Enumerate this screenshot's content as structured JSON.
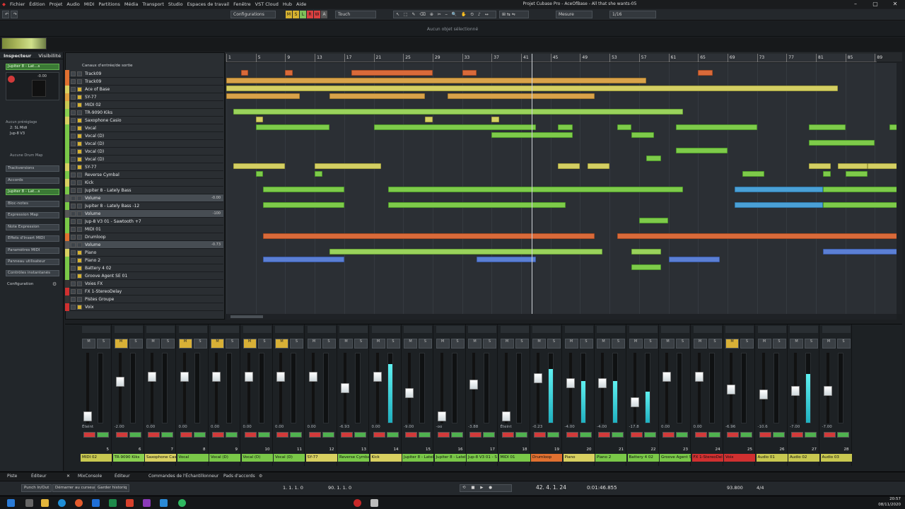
{
  "menu": [
    "Fichier",
    "Édition",
    "Projet",
    "Audio",
    "MIDI",
    "Partitions",
    "Média",
    "Transport",
    "Studio",
    "Espaces de travail",
    "Fenêtre",
    "VST Cloud",
    "Hub",
    "Aide"
  ],
  "window_title": "Projet Cubase Pro - AceOfBase - All that she wants-05",
  "toolbar": {
    "configurations": "Configurations",
    "mode": "Touch",
    "grid_type": "Mesure",
    "quantize": "1/16",
    "msrw": [
      "M",
      "S",
      "L",
      "R",
      "W",
      "A"
    ]
  },
  "info_line": "Aucun objet sélectionné",
  "inspector": {
    "tabs": [
      "Inspecteur",
      "Visibilité"
    ],
    "track": "Jupiter 8 - Lat...s",
    "preset": "Aucun préréglage",
    "instrument": "2: SL Midi",
    "output": "Jup-8 V3",
    "drum_map": "Aucune Drum Map",
    "sections": [
      "Trackversions",
      "Accords",
      "Jupiter 8 - Lat...s",
      "Bloc-notes",
      "Expression Map",
      "Note Expression",
      "Effets d'Insert MIDI",
      "Paramètres MIDI",
      "Panneau utilisateur",
      "Contrôles instantanés",
      "Configuration"
    ],
    "meter_val": "-0.00"
  },
  "track_header": "Canaux d'entrée/de sortie",
  "tracks": [
    {
      "name": "Track09",
      "color": "#e07030",
      "solo": false
    },
    {
      "name": "Track09",
      "color": "#e07030",
      "solo": false
    },
    {
      "name": "Ace of Base",
      "color": "#d8d060",
      "solo": true
    },
    {
      "name": "SY-77",
      "color": "#e0a040",
      "solo": true
    },
    {
      "name": "MIDI 02",
      "color": "#c8c850",
      "solo": true
    },
    {
      "name": "TR-9090 Kiks",
      "color": "#8ad050",
      "solo": false
    },
    {
      "name": "Saxophone Casio",
      "color": "#d8d060",
      "solo": true
    },
    {
      "name": "Vocal",
      "color": "#7ac848",
      "solo": true
    },
    {
      "name": "Vocal (D)",
      "color": "#7ac848",
      "solo": true
    },
    {
      "name": "Vocal (D)",
      "color": "#7ac848",
      "solo": true
    },
    {
      "name": "Vocal (D)",
      "color": "#7ac848",
      "solo": true
    },
    {
      "name": "Vocal (D)",
      "color": "#7ac848",
      "solo": true
    },
    {
      "name": "SY-77",
      "color": "#d8d060",
      "solo": true
    },
    {
      "name": "Reverse Cymbal",
      "color": "#7ac848",
      "solo": false
    },
    {
      "name": "Kick",
      "color": "#d8d060",
      "solo": false
    },
    {
      "name": "Jupiter 8 - Lately Bass",
      "color": "#7ac848",
      "solo": false
    },
    {
      "name": "Volume",
      "color": "#555",
      "solo": false,
      "value": "-0.00"
    },
    {
      "name": "Jupiter 8 - Lately Bass -12",
      "color": "#7ac848",
      "solo": false
    },
    {
      "name": "Volume",
      "color": "#555",
      "solo": false,
      "value": "-100"
    },
    {
      "name": "Jup-8 V3 01 - Sawtooth +7",
      "color": "#7ac848",
      "solo": false
    },
    {
      "name": "MIDI 01",
      "color": "#7ac848",
      "solo": false
    },
    {
      "name": "Drumloop",
      "color": "#e07030",
      "solo": false
    },
    {
      "name": "Volume",
      "color": "#555",
      "solo": false,
      "value": "-0.73"
    },
    {
      "name": "Piano",
      "color": "#d8d060",
      "solo": true
    },
    {
      "name": "Piano 2",
      "color": "#7ac848",
      "solo": true
    },
    {
      "name": "Battery 4 02",
      "color": "#7ac848",
      "solo": true
    },
    {
      "name": "Groove Agent SE 01",
      "color": "#7ac848",
      "solo": true
    },
    {
      "name": "Voies FX",
      "color": "#333",
      "solo": false
    },
    {
      "name": "FX 1-StereoDelay",
      "color": "#d03030",
      "solo": false
    },
    {
      "name": "Pistes Groupe",
      "color": "#333",
      "solo": false
    },
    {
      "name": "Voix",
      "color": "#d03030",
      "solo": true
    }
  ],
  "ruler": [
    "1",
    "5",
    "9",
    "13",
    "17",
    "21",
    "25",
    "29",
    "33",
    "37",
    "41",
    "45",
    "49",
    "53",
    "57",
    "61",
    "65",
    "69",
    "73",
    "77",
    "81",
    "85",
    "89"
  ],
  "mixer": {
    "channels": [
      {
        "num": "5",
        "label": "MIDI 02",
        "color": "#c8c850",
        "val": "Éteint",
        "fader": 0.08,
        "meter": 0,
        "m": false
      },
      {
        "num": "6",
        "label": "TR-9090 Kiks",
        "color": "#8ad050",
        "val": "-2.00",
        "fader": 0.62,
        "meter": 0,
        "m": true
      },
      {
        "num": "7",
        "label": "Saxophone Cas",
        "color": "#d8d060",
        "val": "0.00",
        "fader": 0.7,
        "meter": 0,
        "m": false
      },
      {
        "num": "8",
        "label": "Vocal",
        "color": "#7ac848",
        "val": "0.00",
        "fader": 0.7,
        "meter": 0,
        "m": true
      },
      {
        "num": "9",
        "label": "Vocal (D)",
        "color": "#7ac848",
        "val": "0.00",
        "fader": 0.7,
        "meter": 0,
        "m": true
      },
      {
        "num": "10",
        "label": "Vocal (D)",
        "color": "#7ac848",
        "val": "0.00",
        "fader": 0.7,
        "meter": 0,
        "m": true
      },
      {
        "num": "11",
        "label": "Vocal (D)",
        "color": "#7ac848",
        "val": "0.00",
        "fader": 0.7,
        "meter": 0,
        "m": true
      },
      {
        "num": "12",
        "label": "SY-77",
        "color": "#d8d060",
        "val": "0.00",
        "fader": 0.7,
        "meter": 0,
        "m": false
      },
      {
        "num": "13",
        "label": "Reverse Cymba",
        "color": "#7ac848",
        "val": "-6.93",
        "fader": 0.52,
        "meter": 0,
        "m": false
      },
      {
        "num": "14",
        "label": "Kick",
        "color": "#d8d060",
        "val": "0.00",
        "fader": 0.7,
        "meter": 0.85,
        "m": false
      },
      {
        "num": "15",
        "label": "Jupiter 8 - Latel",
        "color": "#7ac848",
        "val": "-9.00",
        "fader": 0.45,
        "meter": 0,
        "m": false
      },
      {
        "num": "16",
        "label": "Jupiter 8 - Latel",
        "color": "#7ac848",
        "val": "-oo",
        "fader": 0.08,
        "meter": 0,
        "m": false
      },
      {
        "num": "17",
        "label": "Jup-8 V3 01 - S",
        "color": "#7ac848",
        "val": "-3.88",
        "fader": 0.58,
        "meter": 0,
        "m": false
      },
      {
        "num": "18",
        "label": "MIDI 01",
        "color": "#7ac848",
        "val": "Éteint",
        "fader": 0.08,
        "meter": 0,
        "m": false
      },
      {
        "num": "19",
        "label": "Drumloop",
        "color": "#e07030",
        "val": "-0.23",
        "fader": 0.68,
        "meter": 0.78,
        "m": false
      },
      {
        "num": "20",
        "label": "Piano",
        "color": "#d8d060",
        "val": "-4.00",
        "fader": 0.6,
        "meter": 0.6,
        "m": false
      },
      {
        "num": "21",
        "label": "Piano 2",
        "color": "#7ac848",
        "val": "-4.00",
        "fader": 0.6,
        "meter": 0.6,
        "m": false
      },
      {
        "num": "22",
        "label": "Battery 4 02",
        "color": "#7ac848",
        "val": "-17.8",
        "fader": 0.3,
        "meter": 0.45,
        "m": false
      },
      {
        "num": "23",
        "label": "Groove Agent S",
        "color": "#7ac848",
        "val": "0.00",
        "fader": 0.7,
        "meter": 0,
        "m": false
      },
      {
        "num": "24",
        "label": "FX 1-StereoDel",
        "color": "#d03030",
        "val": "0.00",
        "fader": 0.7,
        "meter": 0,
        "m": false
      },
      {
        "num": "25",
        "label": "Voix",
        "color": "#d03030",
        "val": "-6.96",
        "fader": 0.5,
        "meter": 0,
        "m": true
      },
      {
        "num": "26",
        "label": "Audio 01",
        "color": "#c8c850",
        "val": "-10.6",
        "fader": 0.42,
        "meter": 0,
        "m": false
      },
      {
        "num": "27",
        "label": "Audio 02",
        "color": "#c8c850",
        "val": "-7.00",
        "fader": 0.48,
        "meter": 0.7,
        "m": false
      },
      {
        "num": "28",
        "label": "Audio 03",
        "color": "#c8c850",
        "val": "-7.00",
        "fader": 0.48,
        "meter": 0,
        "m": false
      }
    ]
  },
  "zones": [
    "Piste",
    "Éditeur",
    "MixConsole",
    "Éditeur",
    "Commandes de l'Échantillonneur",
    "Pads d'accords"
  ],
  "transport": {
    "left": "1. 1. 1. 0",
    "right": "90. 1. 1. 0",
    "pos_bars": "42. 4. 1. 24",
    "pos_time": "0:01:46.855",
    "tempo": "93.800",
    "signature": "4/4",
    "punch_in": "Punch In/Out",
    "start_cursor": "Démarrer au curseur",
    "history": "Garder historiq"
  },
  "clock": {
    "time": "20:57",
    "date": "08/11/2020"
  }
}
